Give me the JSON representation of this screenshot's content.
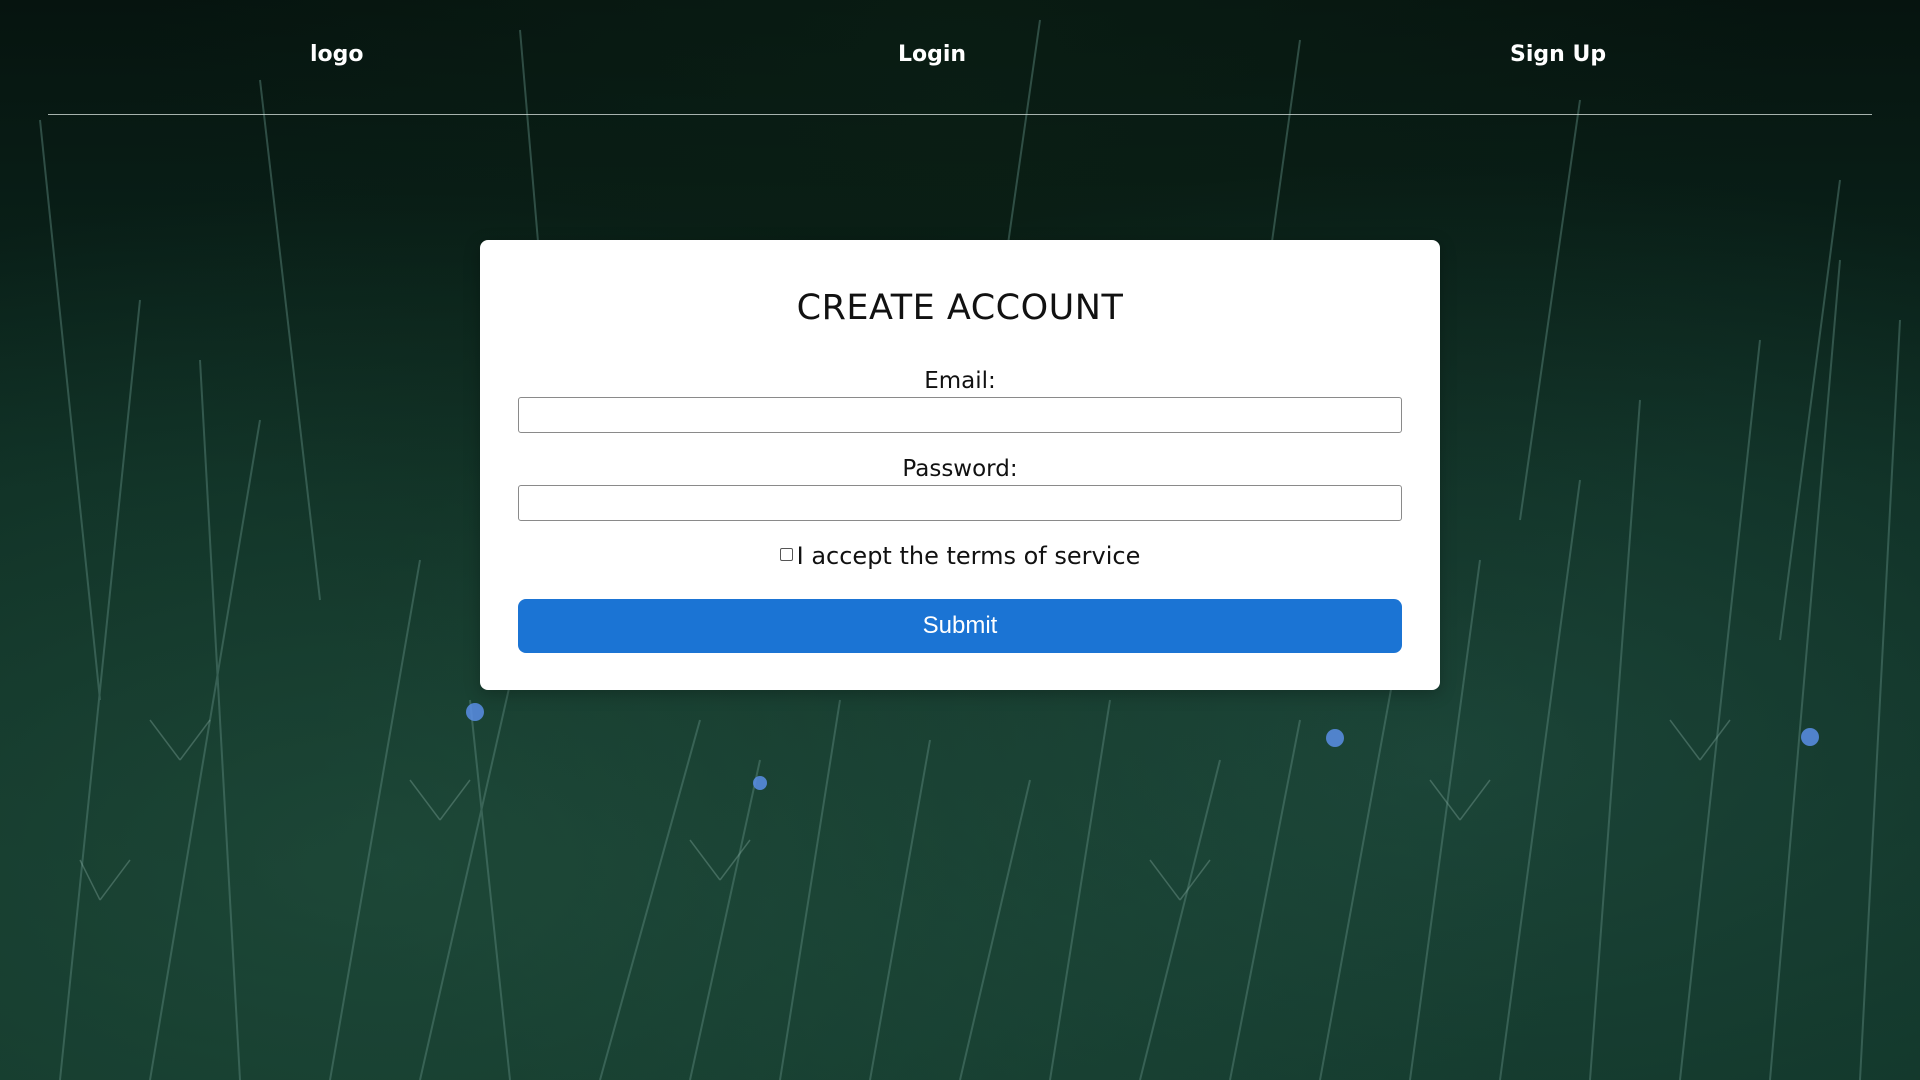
{
  "nav": {
    "logo_label": "logo",
    "login_label": "Login",
    "signup_label": "Sign Up"
  },
  "form": {
    "title": "CREATE ACCOUNT",
    "email_label": "Email:",
    "email_value": "",
    "password_label": "Password:",
    "password_value": "",
    "terms_label": "I accept the terms of service",
    "terms_checked": false,
    "submit_label": "Submit"
  },
  "colors": {
    "accent": "#1b74d4",
    "background": "#0c2a20",
    "card": "#ffffff"
  }
}
